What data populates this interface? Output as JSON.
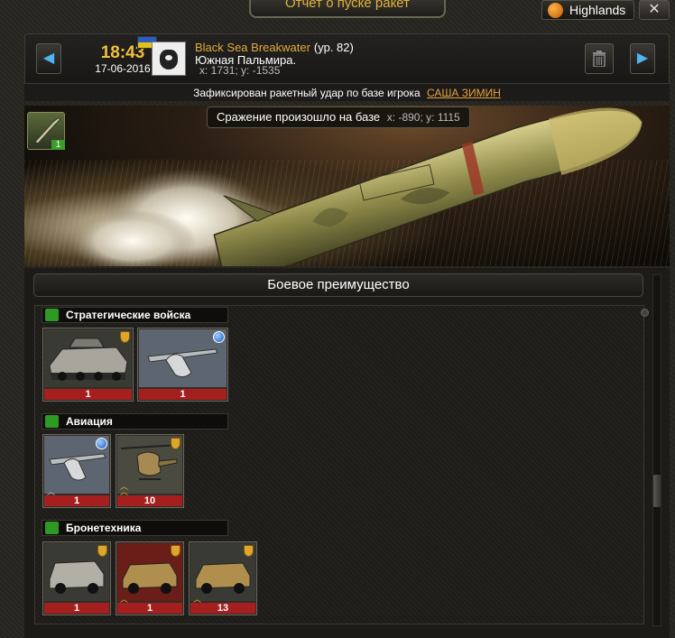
{
  "window": {
    "title": "Отчет о пуске ракет",
    "realm": "Highlands",
    "close_symbol": "✕"
  },
  "header": {
    "time": "18:43",
    "date": "17-06-2016",
    "base_name": "Black Sea Breakwater",
    "base_level": "(ур. 82)",
    "city": "Южная Пальмира.",
    "coords": "x: 1731; y: -1535"
  },
  "notice": {
    "text": "Зафиксирован ракетный удар по базе игрока",
    "player": "САША ЗИМИН"
  },
  "banner": {
    "battle_text": "Сражение произошло на базе",
    "battle_coords": "x: -890; y: 1115",
    "missile_count": "1"
  },
  "content": {
    "section_title": "Боевое преимущество",
    "categories": [
      {
        "name": "Стратегические войска",
        "icon": "strategic-icon",
        "color": "#2f9a23",
        "units": [
          {
            "name": "armored-vehicle",
            "count": "1",
            "badge": "shield"
          },
          {
            "name": "drone",
            "count": "1",
            "badge": "globe"
          }
        ]
      },
      {
        "name": "Авиация",
        "icon": "aviation-wings-icon",
        "color": "#2f9a23",
        "units": [
          {
            "name": "drone",
            "count": "1",
            "badge": "globe",
            "rank": "white"
          },
          {
            "name": "helicopter",
            "count": "10",
            "badge": "shield",
            "rank": "gold"
          }
        ]
      },
      {
        "name": "Бронетехника",
        "icon": "tank-icon",
        "color": "#2f9a23",
        "units": [
          {
            "name": "armored-truck",
            "count": "1",
            "badge": "shield"
          },
          {
            "name": "humvee",
            "count": "1",
            "badge": "shield",
            "rank": "gold"
          },
          {
            "name": "humvee",
            "count": "13",
            "badge": "shield",
            "rank": "gold"
          }
        ]
      }
    ]
  }
}
